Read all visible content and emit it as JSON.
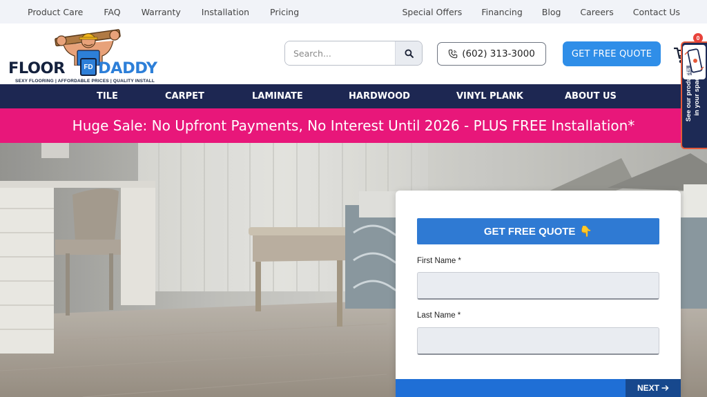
{
  "topbar": {
    "left_links": [
      "Product Care",
      "FAQ",
      "Warranty",
      "Installation",
      "Pricing"
    ],
    "right_links": [
      "Special Offers",
      "Financing",
      "Blog",
      "Careers",
      "Contact Us"
    ]
  },
  "brand": {
    "name_part1": "FLOOR",
    "name_part2": "DADDY",
    "badge": "FD",
    "tagline": "SEXY FLOORING | AFFORDABLE PRICES | QUALITY INSTALL"
  },
  "search": {
    "placeholder": "Search..."
  },
  "phone": {
    "number": "(602) 313-3000"
  },
  "header_cta": {
    "label": "GET FREE QUOTE"
  },
  "cart": {
    "count": "0"
  },
  "nav": [
    "TILE",
    "CARPET",
    "LAMINATE",
    "HARDWOOD",
    "VINYL PLANK",
    "ABOUT US"
  ],
  "promo": {
    "text": "Huge Sale: No Upfront Payments, No Interest Until 2026 - PLUS FREE Installation*"
  },
  "form": {
    "title": "GET FREE QUOTE",
    "title_emoji": "👇",
    "fields": [
      {
        "label": "First Name *",
        "value": ""
      },
      {
        "label": "Last Name *",
        "value": ""
      }
    ],
    "next_label": "NEXT"
  },
  "ar_widget": {
    "text_line1": "See our products",
    "text_line2": "in your space"
  },
  "colors": {
    "topbar_bg": "#f1f3f8",
    "nav_bg": "#1d2752",
    "promo_bg": "#e8177a",
    "cta_blue": "#2f8ee8",
    "form_title_blue": "#2f7ad3",
    "next_bg": "#17488d"
  },
  "icons": {
    "search_button": "search-icon",
    "phone": "phone-icon",
    "cart": "cart-icon",
    "ar": "ar-phone-icon",
    "next": "arrow-right-icon"
  }
}
